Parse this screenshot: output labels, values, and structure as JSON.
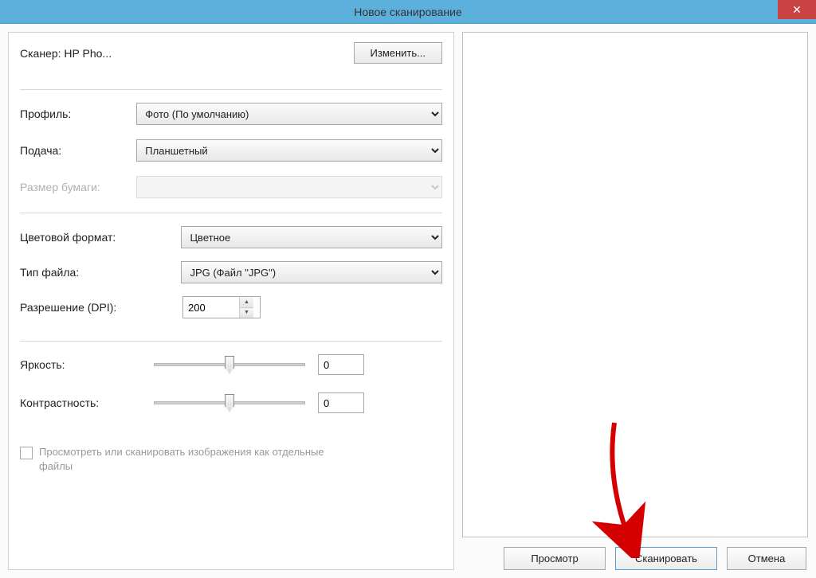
{
  "titlebar": {
    "title": "Новое сканирование"
  },
  "scanner": {
    "label_prefix": "Сканер: ",
    "name": "HP Pho...",
    "change_btn": "Изменить..."
  },
  "profile": {
    "label": "Профиль:",
    "value": "Фото (По умолчанию)"
  },
  "source": {
    "label": "Подача:",
    "value": "Планшетный"
  },
  "paper_size": {
    "label": "Размер бумаги:",
    "value": ""
  },
  "color_format": {
    "label": "Цветовой формат:",
    "value": "Цветное"
  },
  "file_type": {
    "label": "Тип файла:",
    "value": "JPG (Файл \"JPG\")"
  },
  "resolution": {
    "label": "Разрешение (DPI):",
    "value": "200"
  },
  "brightness": {
    "label": "Яркость:",
    "value": "0"
  },
  "contrast": {
    "label": "Контрастность:",
    "value": "0"
  },
  "checkbox": {
    "label": "Просмотреть или сканировать изображения как отдельные файлы"
  },
  "buttons": {
    "preview": "Просмотр",
    "scan": "Сканировать",
    "cancel": "Отмена"
  }
}
